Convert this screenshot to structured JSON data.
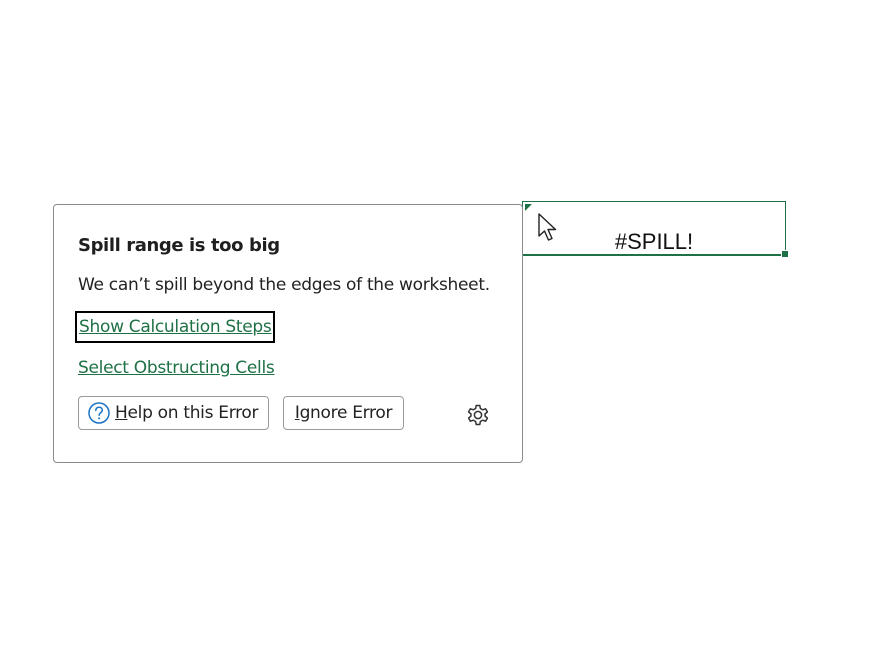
{
  "cell": {
    "value": "#SPILL!"
  },
  "popup": {
    "title": "Spill range is too big",
    "message": "We can’t spill beyond the edges of the worksheet.",
    "links": {
      "show_steps": "Show Calculation Steps",
      "select_obstructing": "Select Obstructing Cells"
    },
    "buttons": {
      "help_accel": "H",
      "help_rest": "elp on this Error",
      "ignore_accel": "I",
      "ignore_rest": "gnore Error"
    },
    "icons": {
      "help": "question-circle-icon",
      "settings": "gear-icon"
    }
  },
  "colors": {
    "accent": "#1e7145",
    "help_icon": "#1a73c4"
  }
}
